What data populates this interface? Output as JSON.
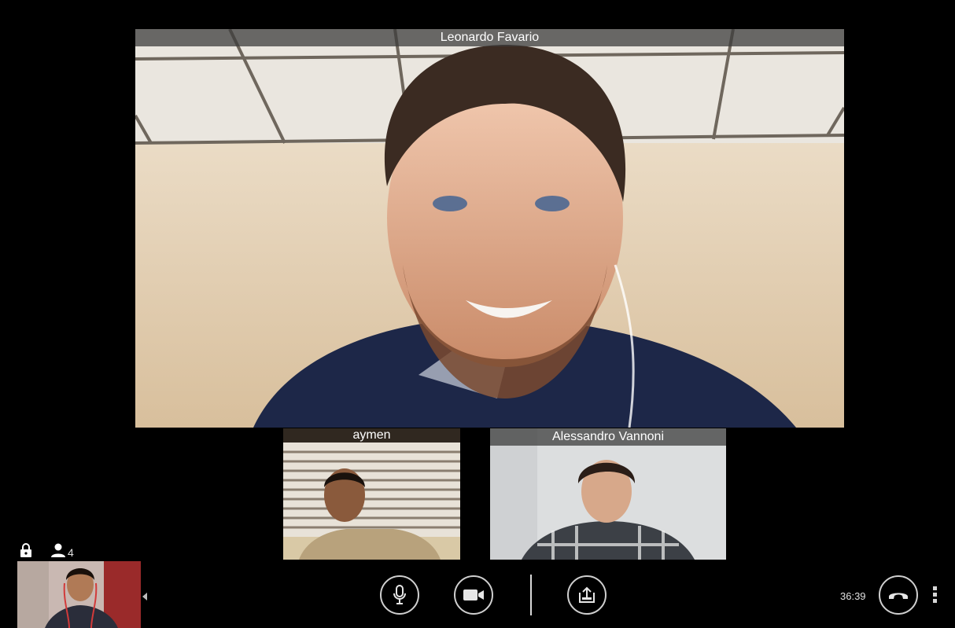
{
  "participants": {
    "main": {
      "name": "Leonardo Favario"
    },
    "second": {
      "name": "aymen"
    },
    "third": {
      "name": "Alessandro Vannoni"
    }
  },
  "status": {
    "participant_count": "4",
    "call_duration": "36:39",
    "icons": [
      "lock-icon",
      "person-icon",
      "microphone-icon",
      "video-camera-icon",
      "share-screen-icon",
      "hang-up-icon",
      "more-vert-icon",
      "caret-left-icon"
    ]
  },
  "colors": {
    "background": "#000000",
    "name_bar": "#3c3c3c",
    "control_border": "#cfcfcf"
  }
}
